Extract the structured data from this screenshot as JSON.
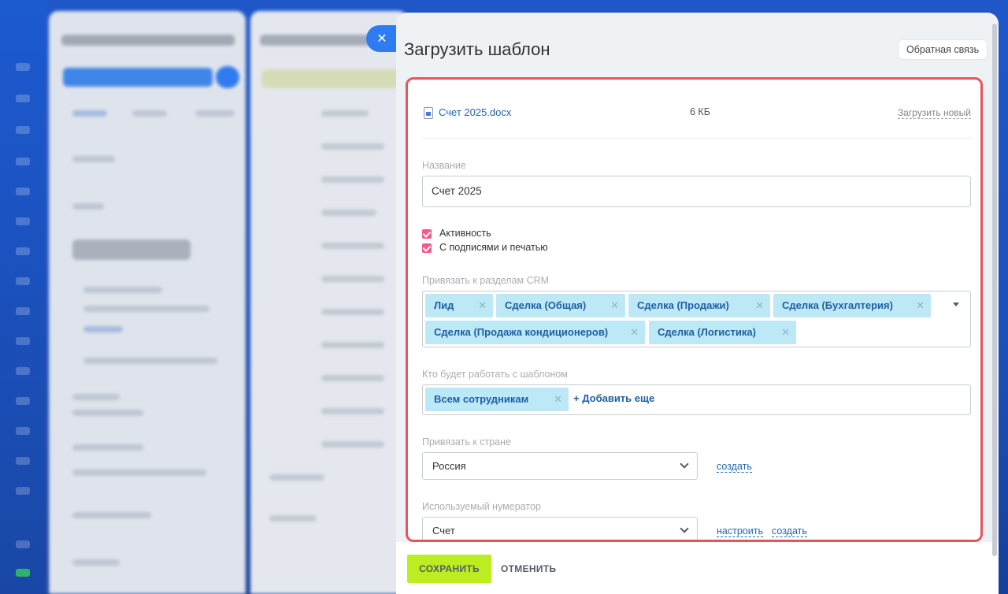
{
  "panel": {
    "title": "Загрузить шаблон",
    "feedback_label": "Обратная связь",
    "close_glyph": "✕"
  },
  "file": {
    "name": "Счет 2025.docx",
    "size": "6 КБ",
    "upload_new_label": "Загрузить новый",
    "icon": "docx-file-icon"
  },
  "name_field": {
    "label": "Название",
    "value": "Счет 2025"
  },
  "checkboxes": [
    {
      "label": "Активность",
      "checked": true
    },
    {
      "label": "С подписями и печатью",
      "checked": true
    }
  ],
  "crm": {
    "label": "Привязать к разделам CRM",
    "tags": [
      "Лид",
      "Сделка (Общая)",
      "Сделка (Продажи)",
      "Сделка (Бухгалтерия)",
      "Сделка (Продажа кондиционеров)",
      "Сделка (Логистика)"
    ]
  },
  "users": {
    "label": "Кто будет работать с шаблоном",
    "tags": [
      "Всем сотрудникам"
    ],
    "add_more": "+ Добавить еще"
  },
  "country": {
    "label": "Привязать к стране",
    "value": "Россия",
    "create_link": "создать"
  },
  "numerator": {
    "label": "Используемый нумератор",
    "value": "Счет",
    "configure_link": "настроить",
    "create_link": "создать"
  },
  "footer": {
    "save_label": "СОХРАНИТЬ",
    "cancel_label": "ОТМЕНИТЬ"
  },
  "colors": {
    "accent_red_frame": "#e8545c",
    "save_green": "#bbed21",
    "tag_blue": "#bde8f6",
    "checkbox_pink": "#f25a8c",
    "link_blue": "#2067b0"
  }
}
